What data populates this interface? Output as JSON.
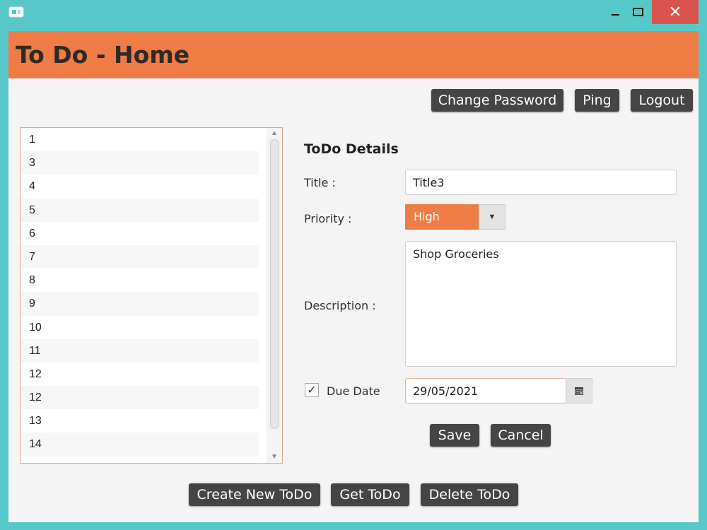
{
  "window": {
    "close_glyph": "✕"
  },
  "header": {
    "title": "To Do - Home"
  },
  "toolbar": {
    "change_password": "Change Password",
    "ping": "Ping",
    "logout": "Logout"
  },
  "todo_list": {
    "items": [
      "1",
      "3",
      "4",
      "5",
      "6",
      "7",
      "8",
      "9",
      "10",
      "11",
      "12",
      "12",
      "13",
      "14"
    ]
  },
  "details": {
    "section_title": "ToDo Details",
    "title_label": "Title :",
    "title_value": "Title3",
    "priority_label": "Priority :",
    "priority_value": "High",
    "description_label": "Description :",
    "description_value": "Shop Groceries",
    "due_date_label": "Due Date",
    "due_date_checked": true,
    "due_date_value": "29/05/2021",
    "save": "Save",
    "cancel": "Cancel"
  },
  "footer": {
    "create": "Create New ToDo",
    "get": "Get ToDo",
    "delete": "Delete ToDo"
  },
  "colors": {
    "accent": "#f07c45",
    "frame": "#57c8c8",
    "button": "#454545"
  }
}
